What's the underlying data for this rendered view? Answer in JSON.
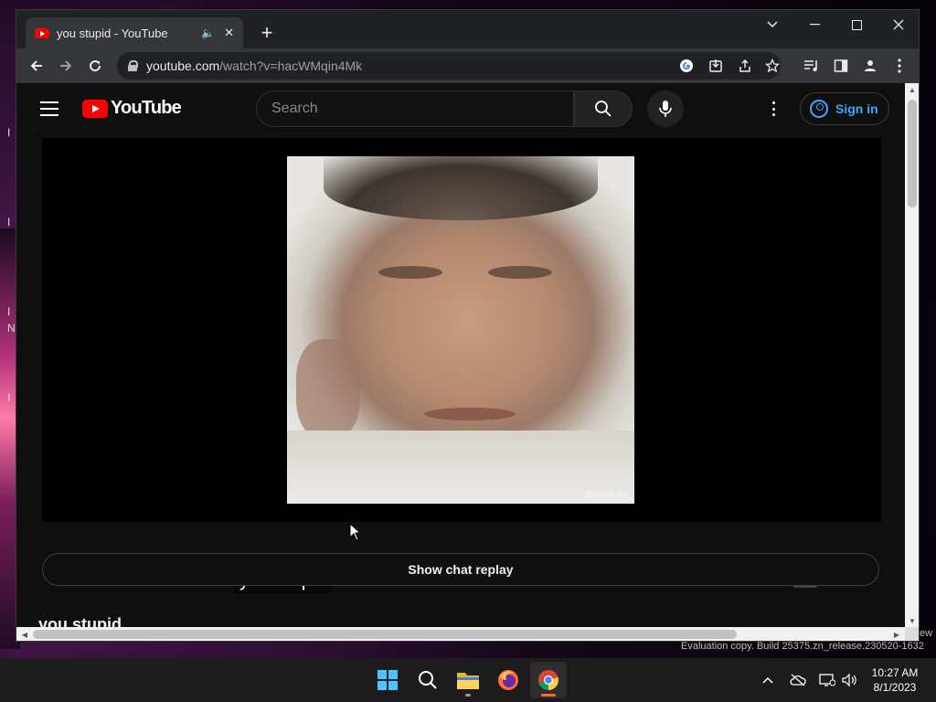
{
  "desktop": {
    "fragments": [
      "I",
      "I",
      "I",
      "N",
      "I"
    ],
    "eval_text": "Evaluation copy. Build 25375.zn_release.230520-1632",
    "eval_text_top": "ew"
  },
  "browser": {
    "tab": {
      "title": "you stupid - YouTube"
    },
    "address": {
      "host": "youtube.com",
      "path": "/watch?v=hacWMqin4Mk"
    }
  },
  "youtube": {
    "logo_text": "YouTube",
    "search": {
      "placeholder": "Search"
    },
    "sign_in_label": "Sign in",
    "caption": "you stupid",
    "watermark": "Broken.bd",
    "chat_replay_label": "Show chat replay",
    "video_title": "you stupid"
  },
  "taskbar": {
    "apps": [
      "start",
      "search",
      "file-explorer",
      "firefox",
      "chrome"
    ],
    "active_app": "chrome",
    "clock": {
      "time": "10:27 AM",
      "date": "8/1/2023"
    }
  },
  "colors": {
    "youtube_red": "#ff0000",
    "signin_blue": "#3ea6ff",
    "page_bg": "#0f0f0f",
    "chrome_frame": "#202124"
  }
}
